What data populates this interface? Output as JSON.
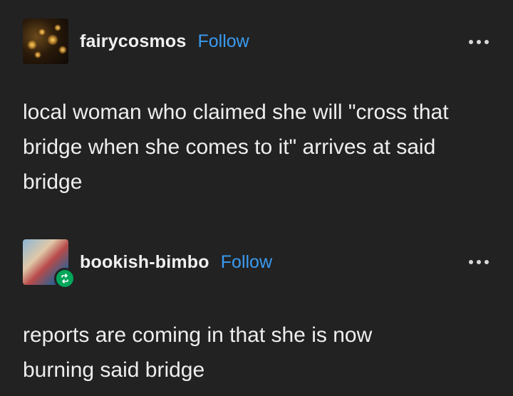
{
  "posts": [
    {
      "username": "fairycosmos",
      "follow_label": "Follow",
      "body_lines": [
        "local woman who claimed she will \"cross that",
        "bridge when she comes to it\" arrives at said",
        "bridge"
      ]
    },
    {
      "username": "bookish-bimbo",
      "follow_label": "Follow",
      "reblog_icon": "reblog-icon",
      "body_lines": [
        "reports are coming in that she is now",
        "burning said bridge"
      ]
    }
  ],
  "colors": {
    "background": "#222223",
    "follow": "#3a9bf0",
    "reblog_badge": "#00a65a"
  },
  "icons": {
    "more": "more-options-icon"
  }
}
